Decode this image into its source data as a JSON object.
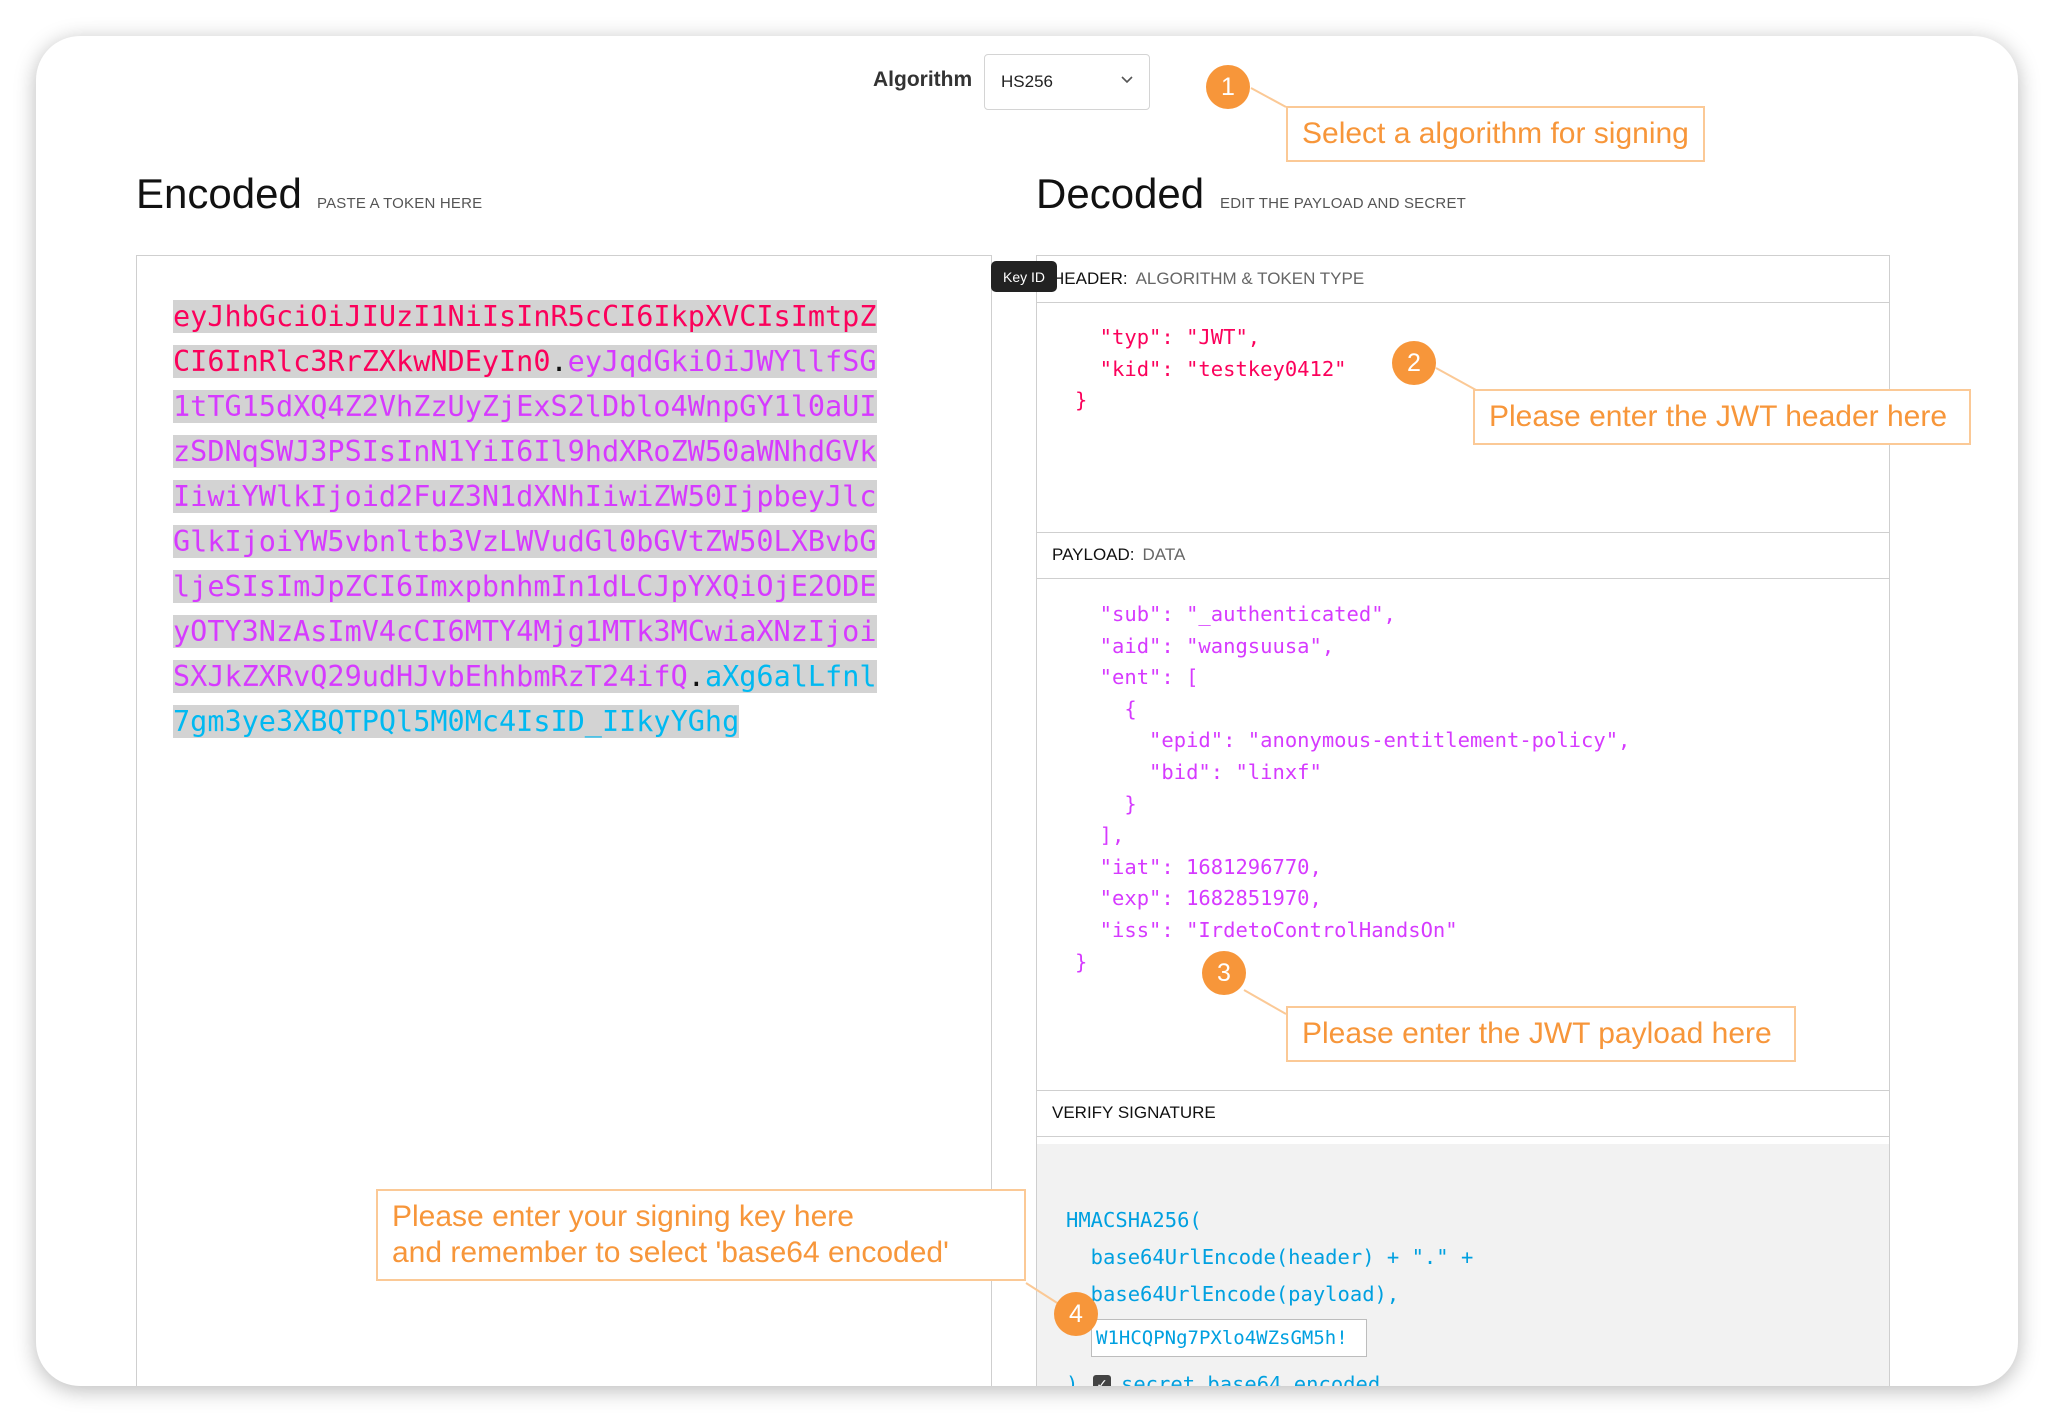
{
  "algorithm": {
    "label": "Algorithm",
    "selected": "HS256"
  },
  "encoded": {
    "title": "Encoded",
    "subtitle": "PASTE A TOKEN HERE",
    "token_header": "eyJhbGciOiJIUzI1NiIsInR5cCI6IkpXVCIsImtpZCI6InRlc3RrZXkwNDEyIn0",
    "token_payload": "eyJqdGkiOiJWYllfSG1tTG15dXQ4Z2VhZzUyZjExS2lDblo4WnpGY1l0aUIzSDNqSWJ3PSIsInN1YiI6Il9hdXRoZW50aWNhdGVkIiwiYWlkIjoid2FuZ3N1dXNhIiwiZW50IjpbeyJlcGlkIjoiYW5vbnltb3VzLWVudGl0bGVtZW50LXBvbGljeSIsImJpZCI6ImxpbnhmIn1dLCJpYXQiOjE2ODEyOTY3NzAsImV4cCI6MTY4Mjg1MTk3MCwiaXNzIjoiSXJkZXRvQ29udHJvbEhhbmRzT24ifQ",
    "token_signature": "aXg6alLfnl7gm3ye3XBQTPQl5M0Mc4IsID_IIkyYGhg",
    "dot": "."
  },
  "decoded": {
    "title": "Decoded",
    "subtitle": "EDIT THE PAYLOAD AND SECRET",
    "header_section": {
      "key": "HEADER:",
      "value": "ALGORITHM & TOKEN TYPE"
    },
    "header_json": "  \"typ\": \"JWT\",\n  \"kid\": \"testkey0412\"\n}",
    "payload_section": {
      "key": "PAYLOAD:",
      "value": "DATA"
    },
    "payload_json": "  \"sub\": \"_authenticated\",\n  \"aid\": \"wangsuusa\",\n  \"ent\": [\n    {\n      \"epid\": \"anonymous-entitlement-policy\",\n      \"bid\": \"linxf\"\n    }\n  ],\n  \"iat\": 1681296770,\n  \"exp\": 1682851970,\n  \"iss\": \"IrdetoControlHandsOn\"\n}",
    "verify_section": "VERIFY SIGNATURE",
    "verify_line1": "HMACSHA256(",
    "verify_line2": "  base64UrlEncode(header) + \".\" +",
    "verify_line3": "  base64UrlEncode(payload),",
    "secret_value": "W1HCQPNg7PXlo4WZsGM5h!",
    "verify_close": ")",
    "checkbox_label": "secret base64 encoded"
  },
  "tooltip": "Key ID",
  "callouts": {
    "c1": {
      "num": "1",
      "text": "Select a algorithm for signing"
    },
    "c2": {
      "num": "2",
      "text": "Please enter the JWT header here"
    },
    "c3": {
      "num": "3",
      "text": "Please enter the JWT payload here"
    },
    "c4": {
      "num": "4",
      "text": "Please enter your signing key here\nand remember to select 'base64 encoded'"
    }
  },
  "colors": {
    "header": "#fb015b",
    "payload": "#d63aff",
    "signature": "#00b9f1",
    "callout": "#f7963a"
  }
}
